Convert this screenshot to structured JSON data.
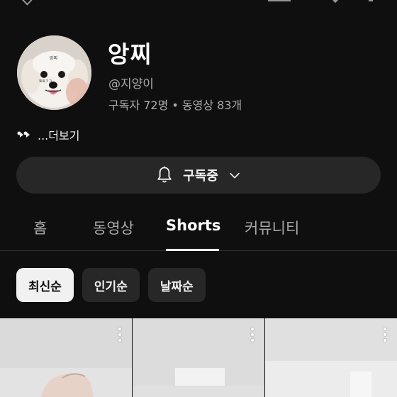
{
  "channel": {
    "name": "앙찌",
    "handle": "@지양이",
    "stats": "구독자 72명 • 동영상 83개",
    "bio": "...더보기",
    "avatar_icon": "dog-avatar"
  },
  "subscribe": {
    "label": "구독중",
    "icon": "bell-icon"
  },
  "tabs": [
    {
      "label": "홈",
      "active": false
    },
    {
      "label": "동영상",
      "active": false
    },
    {
      "label": "Shorts",
      "active": true
    },
    {
      "label": "커뮤니티",
      "active": false
    }
  ],
  "chips": [
    {
      "label": "최신순",
      "active": true
    },
    {
      "label": "인기순",
      "active": false
    },
    {
      "label": "날짜순",
      "active": false
    }
  ],
  "shorts": [
    {
      "icon": "more-vert-icon"
    },
    {
      "icon": "more-vert-icon"
    },
    {
      "icon": "more-vert-icon"
    }
  ],
  "colors": {
    "background": "#0f0f0f",
    "button": "#272727",
    "active_chip": "#f1f1f1",
    "secondary_text": "#aaaaaa"
  }
}
